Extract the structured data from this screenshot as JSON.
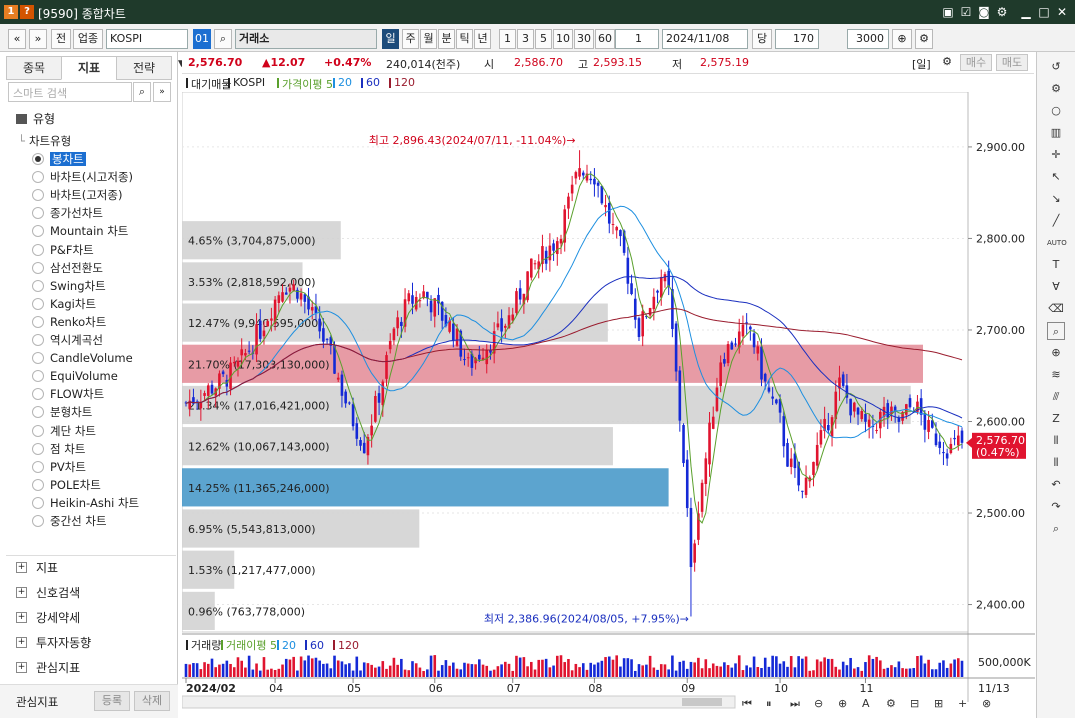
{
  "titlebar": {
    "title": "[9590] 종합차트",
    "icons": [
      "screen-layout-icon",
      "checklist-icon",
      "camera-icon",
      "gear-icon",
      "minimize-icon",
      "maximize-icon",
      "close-icon"
    ]
  },
  "toolbar": {
    "prev_label": "«",
    "down_label": "»",
    "all_label": "전",
    "sector_label": "업종",
    "index_code": "KOSPI",
    "index_num": "01",
    "exchange": "거래소",
    "periods": [
      "일",
      "주",
      "월",
      "분",
      "틱",
      "년"
    ],
    "active_period": "일",
    "intervals": [
      "1",
      "3",
      "5",
      "10",
      "30",
      "60"
    ],
    "count_value": "1",
    "date": "2024/11/08",
    "unit_label": "당",
    "display_count": "170",
    "slash": "/",
    "total_count": "3000"
  },
  "left_panel": {
    "tabs": [
      "종목",
      "지표",
      "전략"
    ],
    "active_tab": "지표",
    "search_placeholder": "스마트 검색",
    "tree_root": "유형",
    "tree_group": "차트유형",
    "chart_types": [
      "봉차트",
      "바차트(시고저종)",
      "바차트(고저종)",
      "종가선차트",
      "Mountain 차트",
      "P&F차트",
      "삼선전환도",
      "Swing차트",
      "Kagi차트",
      "Renko차트",
      "역시계곡선",
      "CandleVolume",
      "EquiVolume",
      "FLOW차트",
      "분형차트",
      "계단 차트",
      "점 차트",
      "PV차트",
      "POLE차트",
      "Heikin-Ashi 차트",
      "중간선 차트"
    ],
    "selected_type": "봉차트",
    "sections": [
      "지표",
      "신호검색",
      "강세약세",
      "투자자동향",
      "관심지표"
    ],
    "footer_label": "관심지표",
    "register_label": "등록",
    "delete_label": "삭제"
  },
  "price_bar": {
    "current": "2,576.70",
    "change": "▲12.07",
    "change_pct": "+0.47%",
    "volume": "240,014(천주)",
    "open_label": "시",
    "open": "2,586.70",
    "high_label": "고",
    "high": "2,593.15",
    "low_label": "저",
    "low": "2,575.19",
    "period_tag": "[일]",
    "buy_label": "매수",
    "sell_label": "매도"
  },
  "legend": {
    "items": [
      {
        "label": "대기매물",
        "color": "#222222"
      },
      {
        "label": "KOSPI",
        "color": "#222222"
      },
      {
        "label": "가격이평 5",
        "color": "#5aa02c"
      },
      {
        "label": "20",
        "color": "#1d8fe0"
      },
      {
        "label": "60",
        "color": "#1a2fbf"
      },
      {
        "label": "120",
        "color": "#9a1c2e"
      }
    ]
  },
  "volume_legend": {
    "items": [
      {
        "label": "거래량",
        "color": "#222222"
      },
      {
        "label": "거래이평 5",
        "color": "#5aa02c"
      },
      {
        "label": "20",
        "color": "#1d8fe0"
      },
      {
        "label": "60",
        "color": "#1a2fbf"
      },
      {
        "label": "120",
        "color": "#9a1c2e"
      }
    ]
  },
  "chart_data": {
    "type": "candlestick",
    "title": "KOSPI",
    "ylim": [
      2370,
      2960
    ],
    "y_ticks": [
      2400,
      2500,
      2600,
      2700,
      2800,
      2900
    ],
    "y_tick_labels": [
      "2,400.00",
      "2,500.00",
      "2,600.00",
      "2,700.00",
      "2,800.00",
      "2,900.00"
    ],
    "x_labels": [
      "2024/02",
      "04",
      "05",
      "06",
      "07",
      "08",
      "09",
      "10",
      "11"
    ],
    "x_end_label": "11/13",
    "volume_tick_label": "500,000K",
    "current_price_label": "2,576.70",
    "current_pct_label": "(0.47%)",
    "current_price": 2576.7,
    "annotations": {
      "high": "최고 2,896.43(2024/07/11, -11.04%)",
      "low": "최저 2,386.96(2024/08/05, +7.95%)"
    },
    "high_value": 2896.43,
    "low_value": 2386.96,
    "volume_profile": [
      {
        "low": 2370,
        "high": 2415,
        "pct_label": "0.96% (763,778,000)",
        "pct": 0.96,
        "highlight": "none"
      },
      {
        "low": 2415,
        "high": 2460,
        "pct_label": "1.53% (1,217,477,000)",
        "pct": 1.53,
        "highlight": "none"
      },
      {
        "low": 2460,
        "high": 2505,
        "pct_label": "6.95% (5,543,813,000)",
        "pct": 6.95,
        "highlight": "none"
      },
      {
        "low": 2505,
        "high": 2550,
        "pct_label": "14.25% (11,365,246,000)",
        "pct": 14.25,
        "highlight": "blue"
      },
      {
        "low": 2550,
        "high": 2595,
        "pct_label": "12.62% (10,067,143,000)",
        "pct": 12.62,
        "highlight": "none"
      },
      {
        "low": 2595,
        "high": 2640,
        "pct_label": "21.34% (17,016,421,000)",
        "pct": 21.34,
        "highlight": "none"
      },
      {
        "low": 2640,
        "high": 2685,
        "pct_label": "21.70% (17,303,130,000)",
        "pct": 21.7,
        "highlight": "red"
      },
      {
        "low": 2685,
        "high": 2730,
        "pct_label": "12.47% (9,940,595,000)",
        "pct": 12.47,
        "highlight": "none"
      },
      {
        "low": 2730,
        "high": 2775,
        "pct_label": "3.53% (2,818,592,000)",
        "pct": 3.53,
        "highlight": "none"
      },
      {
        "low": 2775,
        "high": 2820,
        "pct_label": "4.65% (3,704,875,000)",
        "pct": 4.65,
        "highlight": "none"
      }
    ],
    "close_keypoints": [
      [
        0,
        2620
      ],
      [
        10,
        2645
      ],
      [
        14,
        2660
      ],
      [
        20,
        2700
      ],
      [
        26,
        2750
      ],
      [
        30,
        2745
      ],
      [
        36,
        2700
      ],
      [
        40,
        2660
      ],
      [
        44,
        2610
      ],
      [
        48,
        2575
      ],
      [
        52,
        2630
      ],
      [
        56,
        2700
      ],
      [
        60,
        2730
      ],
      [
        64,
        2740
      ],
      [
        68,
        2720
      ],
      [
        72,
        2700
      ],
      [
        76,
        2660
      ],
      [
        80,
        2680
      ],
      [
        84,
        2695
      ],
      [
        88,
        2720
      ],
      [
        92,
        2760
      ],
      [
        96,
        2780
      ],
      [
        100,
        2800
      ],
      [
        104,
        2850
      ],
      [
        106,
        2880
      ],
      [
        110,
        2870
      ],
      [
        114,
        2820
      ],
      [
        118,
        2780
      ],
      [
        122,
        2700
      ],
      [
        126,
        2740
      ],
      [
        128,
        2760
      ],
      [
        130,
        2740
      ],
      [
        134,
        2560
      ],
      [
        136,
        2440
      ],
      [
        138,
        2510
      ],
      [
        140,
        2560
      ],
      [
        144,
        2670
      ],
      [
        148,
        2690
      ],
      [
        152,
        2700
      ],
      [
        156,
        2640
      ],
      [
        160,
        2600
      ],
      [
        162,
        2560
      ],
      [
        166,
        2520
      ],
      [
        168,
        2550
      ],
      [
        172,
        2590
      ],
      [
        176,
        2640
      ],
      [
        180,
        2610
      ],
      [
        184,
        2590
      ],
      [
        188,
        2610
      ],
      [
        192,
        2600
      ],
      [
        196,
        2620
      ],
      [
        200,
        2590
      ],
      [
        204,
        2575
      ],
      [
        206,
        2570
      ],
      [
        208,
        2577
      ]
    ],
    "candle_count": 210
  }
}
